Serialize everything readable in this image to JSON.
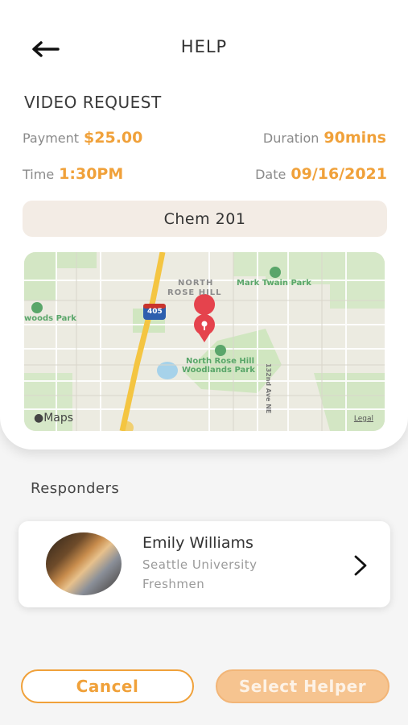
{
  "header": {
    "title": "HELP",
    "back_icon": "arrow-left-icon"
  },
  "request": {
    "type_label": "VIDEO REQUEST",
    "payment_label": "Payment",
    "payment_value": "$25.00",
    "duration_label": "Duration",
    "duration_value": "90mins",
    "time_label": "Time",
    "time_value": "1:30PM",
    "date_label": "Date",
    "date_value": "09/16/2021",
    "course": "Chem 201"
  },
  "map": {
    "labels": {
      "north_rose_hill_1": "NORTH",
      "north_rose_hill_2": "ROSE HILL",
      "mark_twain_park": "Mark Twain Park",
      "woods_park": "woods Park",
      "north_rose_hill_park_1": "North Rose Hill",
      "north_rose_hill_park_2": "Woodlands Park",
      "highway": "405",
      "street": "132nd Ave NE",
      "brand": "Maps",
      "legal": "Legal"
    }
  },
  "responders": {
    "title": "Responders",
    "items": [
      {
        "name": "Emily Williams",
        "school": "Seattle University",
        "year": "Freshmen"
      }
    ]
  },
  "actions": {
    "cancel_label": "Cancel",
    "select_label": "Select Helper"
  },
  "colors": {
    "accent": "#f0a13a",
    "accent_light": "#f6c490",
    "course_bg": "#f3ece5"
  }
}
